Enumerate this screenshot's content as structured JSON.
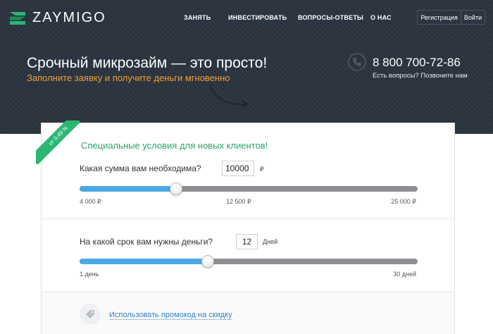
{
  "header": {
    "brand": "ZAYMIGO",
    "brand_color": "#2bb673",
    "nav": [
      {
        "label": "ЗАНЯТЬ"
      },
      {
        "label": "ИНВЕСТИРОВАТЬ"
      },
      {
        "label": "ВОПРОСЫ-ОТВЕТЫ"
      },
      {
        "label": "О НАС"
      }
    ],
    "register_label": "Регистрация",
    "login_label": "Войти"
  },
  "hero": {
    "title": "Срочный микрозайм — это просто!",
    "subtitle": "Заполните заявку и получите деньги мгновенно",
    "subtitle_color": "#f0a13a",
    "phone": "8 800 700-72-86",
    "phone_caption": "Есть вопросы? Позвоните нам",
    "phone_icon": "phone-icon"
  },
  "offer": {
    "badge": "от 0,49 %",
    "title": "Специальные условия для новых клиентов!"
  },
  "amount": {
    "label": "Какая сумма вам необходима?",
    "value": "10000",
    "unit": "₽",
    "min_label": "4 000 ₽",
    "mid_label": "12 500 ₽",
    "max_label": "25 000 ₽",
    "min": 4000,
    "max": 25000,
    "current": 10000
  },
  "term": {
    "label": "На какой срок вам нужны деньги?",
    "value": "12",
    "unit": "Дней",
    "min_label": "1 день",
    "max_label": "30 дней",
    "min": 1,
    "max": 30,
    "current": 12
  },
  "promo": {
    "link": "Использовать промокод на скидку",
    "icon": "tag-icon"
  },
  "colors": {
    "accent": "#2bb673",
    "slider_fill": "#4aa8e2",
    "link": "#2e83c4"
  }
}
